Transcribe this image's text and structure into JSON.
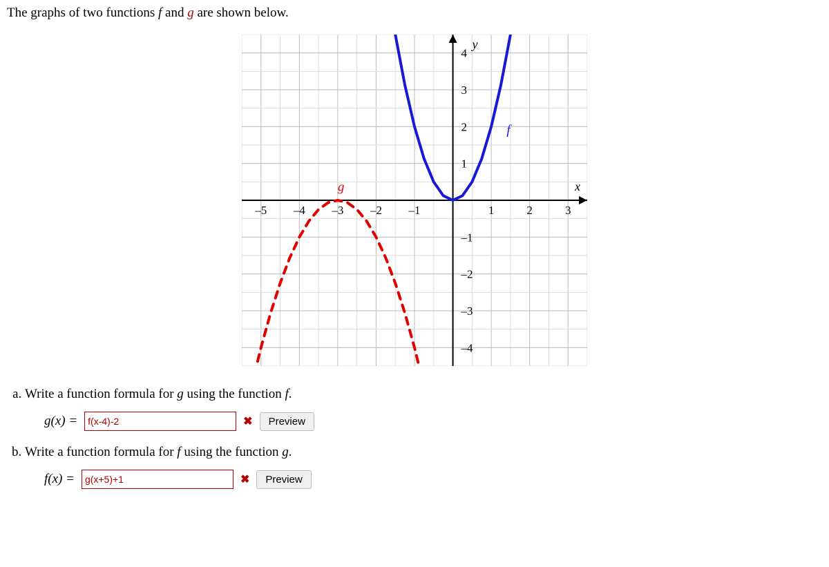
{
  "intro_pre": "The graphs of two functions ",
  "intro_mid": " and ",
  "intro_post": " are shown below.",
  "f_letter": "f",
  "g_letter": "g",
  "questions": {
    "a": {
      "text_pre": "Write a function formula for ",
      "text_mid": " using the function ",
      "text_post": ".",
      "fn_out": "g",
      "fn_in": "f",
      "lhs": "g(x) = ",
      "input_value": "f(x-4)-2",
      "preview_label": "Preview"
    },
    "b": {
      "text_pre": "Write a function formula for ",
      "text_mid": " using the function ",
      "text_post": ".",
      "fn_out": "f",
      "fn_in": "g",
      "lhs": "f(x) = ",
      "input_value": "g(x+5)+1",
      "preview_label": "Preview"
    }
  },
  "chart_data": {
    "type": "line",
    "title": "",
    "xlabel": "x",
    "ylabel": "y",
    "xlim": [
      -5.5,
      3.5
    ],
    "ylim": [
      -4.5,
      4.5
    ],
    "xticks": [
      -5,
      -4,
      -3,
      -2,
      -1,
      1,
      2,
      3
    ],
    "yticks": [
      -4,
      -3,
      -2,
      -1,
      1,
      2,
      3,
      4
    ],
    "series": [
      {
        "name": "f",
        "color": "#1818d6",
        "style": "solid",
        "label_xy": [
          1.4,
          1.8
        ],
        "x": [
          -1.5,
          -1.25,
          -1,
          -0.75,
          -0.5,
          -0.25,
          0,
          0.25,
          0.5,
          0.75,
          1,
          1.25,
          1.5
        ],
        "y": [
          4.5,
          3.125,
          2,
          1.125,
          0.5,
          0.125,
          0,
          0.125,
          0.5,
          1.125,
          2,
          3.125,
          4.5
        ]
      },
      {
        "name": "g",
        "color": "#e00000",
        "style": "dashed",
        "label_xy": [
          -3,
          0.25
        ],
        "x": [
          -5.25,
          -5,
          -4.75,
          -4.5,
          -4.25,
          -4,
          -3.75,
          -3.5,
          -3.25,
          -3,
          -2.75,
          -2.5,
          -2.25,
          -2,
          -1.75,
          -1.5,
          -1.25,
          -1,
          -0.75
        ],
        "y": [
          -5.0625,
          -4,
          -3.0625,
          -2.25,
          -1.5625,
          -1,
          -0.5625,
          -0.25,
          -0.0625,
          0,
          -0.0625,
          -0.25,
          -0.5625,
          -1,
          -1.5625,
          -2.25,
          -3.0625,
          -4,
          -5.0625
        ]
      }
    ]
  }
}
